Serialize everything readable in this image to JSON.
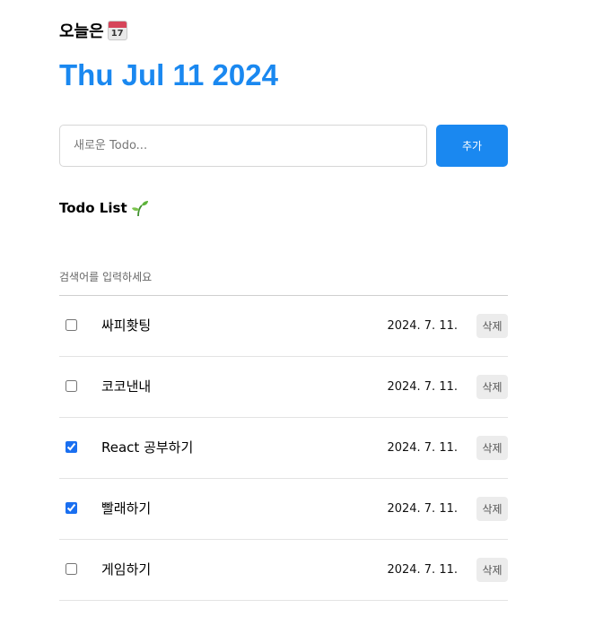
{
  "header": {
    "label": "오늘은",
    "calendar_icon_day": "17",
    "date": "Thu Jul 11 2024"
  },
  "editor": {
    "placeholder": "새로운 Todo...",
    "value": "",
    "add_label": "추가"
  },
  "list": {
    "title": "Todo List",
    "search_placeholder": "검색어를 입력하세요",
    "items": [
      {
        "content": "싸피홧팅",
        "done": false,
        "date": "2024. 7. 11.",
        "delete_label": "삭제"
      },
      {
        "content": "코코낸내",
        "done": false,
        "date": "2024. 7. 11.",
        "delete_label": "삭제"
      },
      {
        "content": "React 공부하기",
        "done": true,
        "date": "2024. 7. 11.",
        "delete_label": "삭제"
      },
      {
        "content": "빨래하기",
        "done": true,
        "date": "2024. 7. 11.",
        "delete_label": "삭제"
      },
      {
        "content": "게임하기",
        "done": false,
        "date": "2024. 7. 11.",
        "delete_label": "삭제"
      }
    ]
  },
  "colors": {
    "accent": "#1a88f0",
    "delete_bg": "#ececec"
  },
  "icons": {
    "header": "calendar-icon",
    "list_title": "sprout-icon"
  }
}
